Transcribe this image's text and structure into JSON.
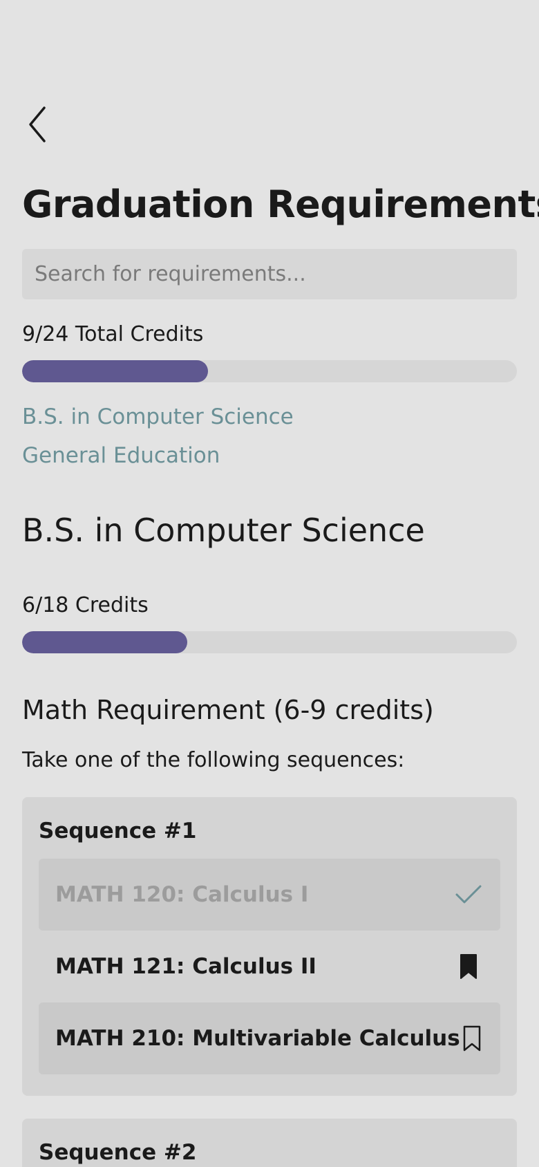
{
  "header": {
    "back_icon": "chevron-left-icon",
    "title": "Graduation Requirements"
  },
  "search": {
    "placeholder": "Search for requirements...",
    "value": ""
  },
  "total": {
    "label": "9/24 Total Credits",
    "earned": 9,
    "required": 24,
    "progress_fraction": 0.375
  },
  "sections_nav": [
    {
      "label": "B.S. in Computer Science"
    },
    {
      "label": "General Education"
    }
  ],
  "major": {
    "title": "B.S. in Computer Science",
    "credits_label": "6/18 Credits",
    "earned": 6,
    "required": 18,
    "progress_fraction": 0.3333
  },
  "math_requirement": {
    "title": "Math Requirement (6-9 credits)",
    "instructions": "Take one of the following sequences:",
    "sequences": [
      {
        "title": "Sequence #1",
        "courses": [
          {
            "name": "MATH 120: Calculus I",
            "status": "completed",
            "icon": "checkmark-icon"
          },
          {
            "name": "MATH 121: Calculus II",
            "status": "bookmarked",
            "icon": "bookmark-filled-icon"
          },
          {
            "name": "MATH 210: Multivariable Calculus",
            "status": "not-bookmarked",
            "icon": "bookmark-outline-icon"
          }
        ]
      },
      {
        "title": "Sequence #2",
        "courses": []
      }
    ]
  },
  "colors": {
    "background": "#e3e3e3",
    "progress_fill": "#5f5890",
    "progress_track": "#d6d6d6",
    "link": "#6a9096",
    "checkmark": "#6a9096"
  }
}
